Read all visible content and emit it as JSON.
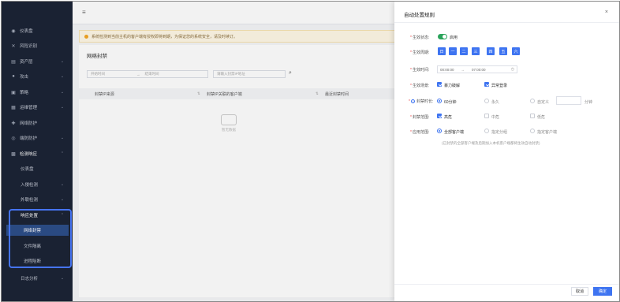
{
  "sidebar": {
    "items": [
      {
        "label": "仪表盘",
        "icon": "dashboard-icon",
        "chevron": ""
      },
      {
        "label": "风险识别",
        "icon": "risk-icon",
        "chevron": ""
      },
      {
        "label": "资产层",
        "icon": "asset-icon",
        "chevron": "⌄"
      },
      {
        "label": "攻击",
        "icon": "attack-icon",
        "chevron": "⌄"
      },
      {
        "label": "策略",
        "icon": "policy-icon",
        "chevron": "⌄"
      },
      {
        "label": "运维管理",
        "icon": "ops-icon",
        "chevron": "⌄"
      },
      {
        "label": "网络防护",
        "icon": "network-icon",
        "chevron": ""
      },
      {
        "label": "端防防护",
        "icon": "endpoint-icon",
        "chevron": "⌄"
      },
      {
        "label": "检测响应",
        "icon": "detect-icon",
        "chevron": "⌃"
      },
      {
        "label": "仪表盘",
        "icon": "",
        "chevron": "",
        "sub": true
      },
      {
        "label": "入侵检测",
        "icon": "",
        "chevron": "⌄",
        "sub": true
      },
      {
        "label": "外联检测",
        "icon": "",
        "chevron": "⌄",
        "sub": true
      },
      {
        "label": "响应处置",
        "icon": "",
        "chevron": "⌃",
        "sub": true
      },
      {
        "label": "网络封禁",
        "icon": "",
        "chevron": "",
        "sub": true,
        "deep": true
      },
      {
        "label": "文件隔离",
        "icon": "",
        "chevron": "",
        "sub": true,
        "deep": true
      },
      {
        "label": "进程阻断",
        "icon": "",
        "chevron": "",
        "sub": true,
        "deep": true
      },
      {
        "label": "日志分析",
        "icon": "",
        "chevron": "⌄",
        "sub": true
      }
    ]
  },
  "topbar": {
    "menu_icon": "≡"
  },
  "notice": {
    "text": "系统检测到当前主机的客户端有授权即将到期，为保证您的系统安全，请及时续订。"
  },
  "panel": {
    "title": "网络封禁",
    "filter_start": "开始时间",
    "filter_to": "→",
    "filter_end": "结束时间",
    "filter_ip_placeholder": "请输入封禁IP地址",
    "search_icon": "⌕",
    "columns": [
      "封禁IP来源",
      "封禁IP关联的客户端",
      "最近封禁时间"
    ],
    "empty_text": "暂无数据"
  },
  "drawer": {
    "title": "自动处置规则",
    "close": "×",
    "status_label": "生效状态:",
    "status_text": "启用",
    "period_label": "生效周期:",
    "days": [
      "日",
      "一",
      "二",
      "三",
      "四",
      "五",
      "六"
    ],
    "time_label": "生效时间:",
    "time_start": "00:00:00",
    "time_sep": "→",
    "time_end": "07:00:00",
    "clock_icon": "◷",
    "scene_label": "生效场景:",
    "scene_options": [
      {
        "label": "暴力破解",
        "checked": true
      },
      {
        "label": "异常登录",
        "checked": true
      }
    ],
    "duration_label": "封禁时长:",
    "duration_options": [
      {
        "label": "60分钟",
        "selected": true
      },
      {
        "label": "永久",
        "selected": false
      },
      {
        "label": "自定义",
        "selected": false
      }
    ],
    "duration_unit": "分钟",
    "range_label": "封禁范围:",
    "range_options": [
      {
        "label": "高危",
        "checked": true
      },
      {
        "label": "中危",
        "checked": false
      },
      {
        "label": "低危",
        "checked": false
      }
    ],
    "apply_label": "应用范围:",
    "apply_options": [
      {
        "label": "全部客户端",
        "selected": true
      },
      {
        "label": "指定分组",
        "selected": false
      },
      {
        "label": "指定客户端",
        "selected": false
      }
    ],
    "hint": "(已封禁的全部客户端及后期加入本机客户端都将生效自动封禁)",
    "cancel": "取消",
    "ok": "确定"
  }
}
